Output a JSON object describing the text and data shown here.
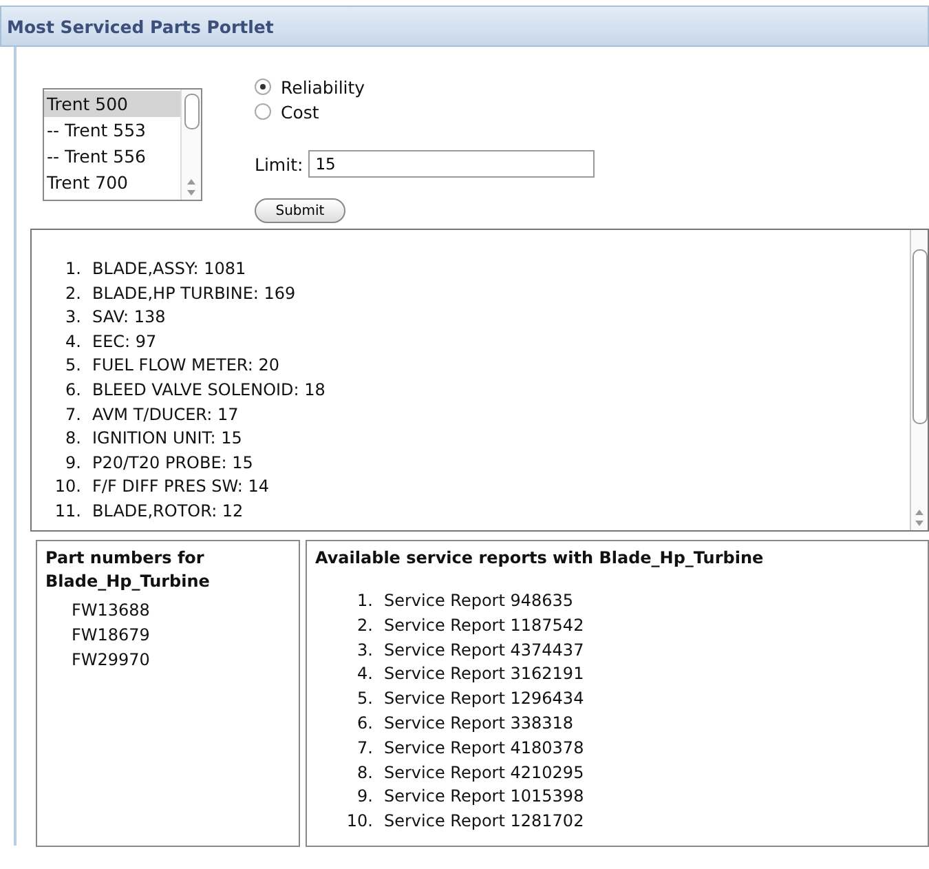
{
  "portlet": {
    "title": "Most Serviced Parts Portlet"
  },
  "engine_list": {
    "items": [
      {
        "label": "Trent 500",
        "selected": true
      },
      {
        "label": "-- Trent 553",
        "selected": false
      },
      {
        "label": "-- Trent 556",
        "selected": false
      },
      {
        "label": "Trent 700",
        "selected": false
      }
    ]
  },
  "sort_options": [
    {
      "label": "Reliability",
      "selected": true
    },
    {
      "label": "Cost",
      "selected": false
    }
  ],
  "limit": {
    "label": "Limit:",
    "value": "15"
  },
  "submit_button": "Submit",
  "results": [
    {
      "number": "1.",
      "text": "BLADE,ASSY: 1081"
    },
    {
      "number": "2.",
      "text": "BLADE,HP TURBINE: 169"
    },
    {
      "number": "3.",
      "text": "SAV: 138"
    },
    {
      "number": "4.",
      "text": "EEC: 97"
    },
    {
      "number": "5.",
      "text": "FUEL FLOW METER: 20"
    },
    {
      "number": "6.",
      "text": "BLEED VALVE SOLENOID: 18"
    },
    {
      "number": "7.",
      "text": "AVM T/DUCER: 17"
    },
    {
      "number": "8.",
      "text": "IGNITION UNIT: 15"
    },
    {
      "number": "9.",
      "text": "P20/T20 PROBE: 15"
    },
    {
      "number": "10.",
      "text": "F/F DIFF PRES SW: 14"
    },
    {
      "number": "11.",
      "text": "BLADE,ROTOR: 12"
    }
  ],
  "part_numbers": {
    "heading": "Part numbers for Blade_Hp_Turbine",
    "items": [
      "FW13688",
      "FW18679",
      "FW29970"
    ]
  },
  "service_reports": {
    "heading": "Available service reports with Blade_Hp_Turbine",
    "items": [
      {
        "number": "1.",
        "text": "Service Report 948635"
      },
      {
        "number": "2.",
        "text": "Service Report 1187542"
      },
      {
        "number": "3.",
        "text": "Service Report 4374437"
      },
      {
        "number": "4.",
        "text": "Service Report 3162191"
      },
      {
        "number": "5.",
        "text": "Service Report 1296434"
      },
      {
        "number": "6.",
        "text": "Service Report 338318"
      },
      {
        "number": "7.",
        "text": "Service Report 4180378"
      },
      {
        "number": "8.",
        "text": "Service Report 4210295"
      },
      {
        "number": "9.",
        "text": "Service Report 1015398"
      },
      {
        "number": "10.",
        "text": "Service Report 1281702"
      }
    ]
  }
}
